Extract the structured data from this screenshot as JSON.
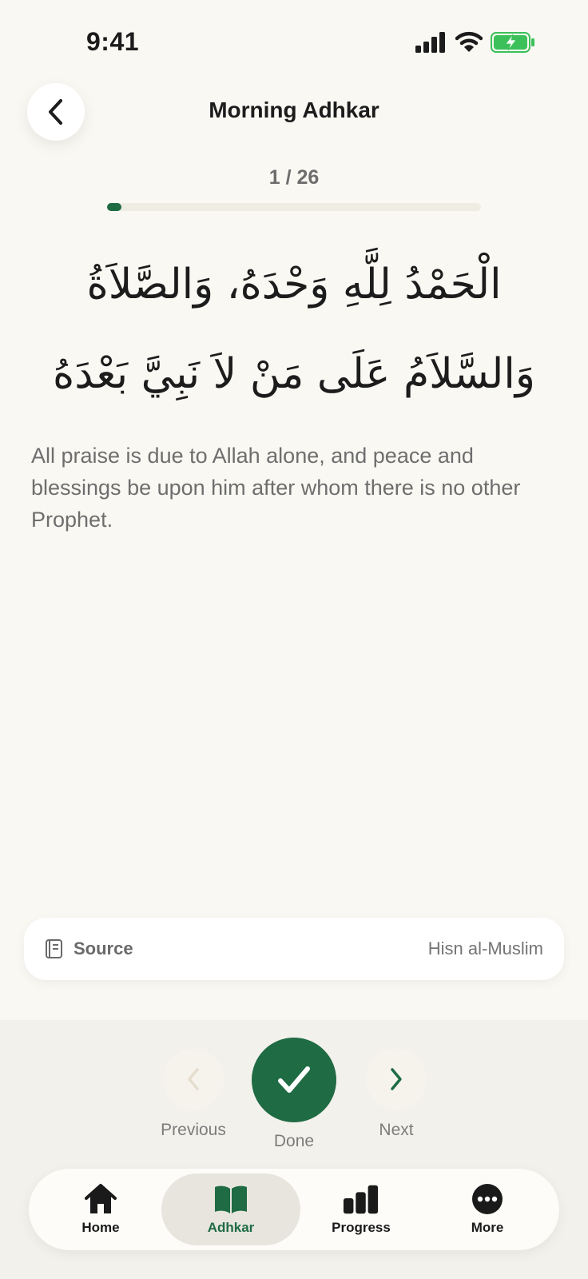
{
  "status_bar": {
    "time": "9:41"
  },
  "header": {
    "title": "Morning Adhkar"
  },
  "progress": {
    "label": "1 / 26",
    "current": 1,
    "total": 26
  },
  "dhikr": {
    "arabic": "الْحَمْدُ لِلَّهِ وَحْدَهُ، وَالصَّلاَةُ وَالسَّلاَمُ عَلَى مَنْ لاَ نَبِيَّ بَعْدَهُ",
    "translation": "All praise is due to Allah alone, and peace and blessings be upon him after whom there is no other Prophet."
  },
  "source": {
    "label": "Source",
    "value": "Hisn al-Muslim"
  },
  "controls": {
    "previous_label": "Previous",
    "done_label": "Done",
    "next_label": "Next"
  },
  "tabs": [
    {
      "label": "Home",
      "icon": "home-icon",
      "active": false
    },
    {
      "label": "Adhkar",
      "icon": "book-icon",
      "active": true
    },
    {
      "label": "Progress",
      "icon": "bar-chart-icon",
      "active": false
    },
    {
      "label": "More",
      "icon": "more-icon",
      "active": false
    }
  ],
  "colors": {
    "accent": "#1f6b44",
    "background": "#faf8f3",
    "battery": "#3cc15a"
  }
}
